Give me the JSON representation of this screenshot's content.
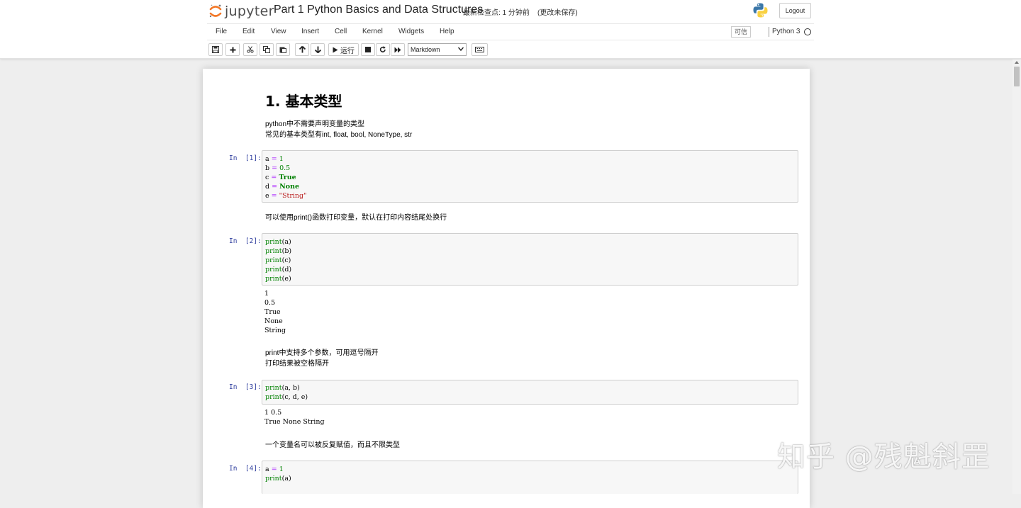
{
  "header": {
    "app_name": "jupyter",
    "notebook_title": "Part 1 Python Basics and Data Structures",
    "checkpoint": "最新检查点: 1 分钟前",
    "autosave_status": "(更改未保存)",
    "logout_label": "Logout"
  },
  "menubar": {
    "items": [
      "File",
      "Edit",
      "View",
      "Insert",
      "Cell",
      "Kernel",
      "Widgets",
      "Help"
    ],
    "trusted_label": "可信",
    "kernel_name": "Python 3"
  },
  "toolbar": {
    "run_label": "运行",
    "cell_type": "Markdown"
  },
  "notebook": {
    "heading": "1. 基本类型",
    "intro_lines": [
      "python中不需要声明变量的类型",
      "常见的基本类型有int, float, bool, NoneType, str"
    ],
    "cell1": {
      "prompt": "In  [1]:",
      "code": [
        "a = 1",
        "b = 0.5",
        "c = True",
        "d = None",
        "e = \"String\""
      ]
    },
    "md2": "可以使用print()函数打印变量，默认在打印内容结尾处换行",
    "cell2": {
      "prompt": "In  [2]:",
      "code": [
        "print(a)",
        "print(b)",
        "print(c)",
        "print(d)",
        "print(e)"
      ],
      "output": [
        "1",
        "0.5",
        "True",
        "None",
        "String"
      ]
    },
    "md3_lines": [
      "print中支持多个参数，可用逗号隔开",
      "打印结果被空格隔开"
    ],
    "cell3": {
      "prompt": "In  [3]:",
      "code": [
        "print(a, b)",
        "print(c, d, e)"
      ],
      "output": [
        "1 0.5",
        "True None String"
      ]
    },
    "md4": "一个变量名可以被反复赋值，而且不限类型",
    "cell4": {
      "prompt": "In  [4]:",
      "code": [
        "a = 1",
        "print(a)"
      ]
    }
  },
  "watermark": "知乎 @残魁斜罡",
  "colors": {
    "prompt_blue": "#303f9f",
    "builtin_green": "#008000",
    "operator_purple": "#aa22ff",
    "string_red": "#ba2121",
    "jupyter_orange": "#f37726"
  }
}
